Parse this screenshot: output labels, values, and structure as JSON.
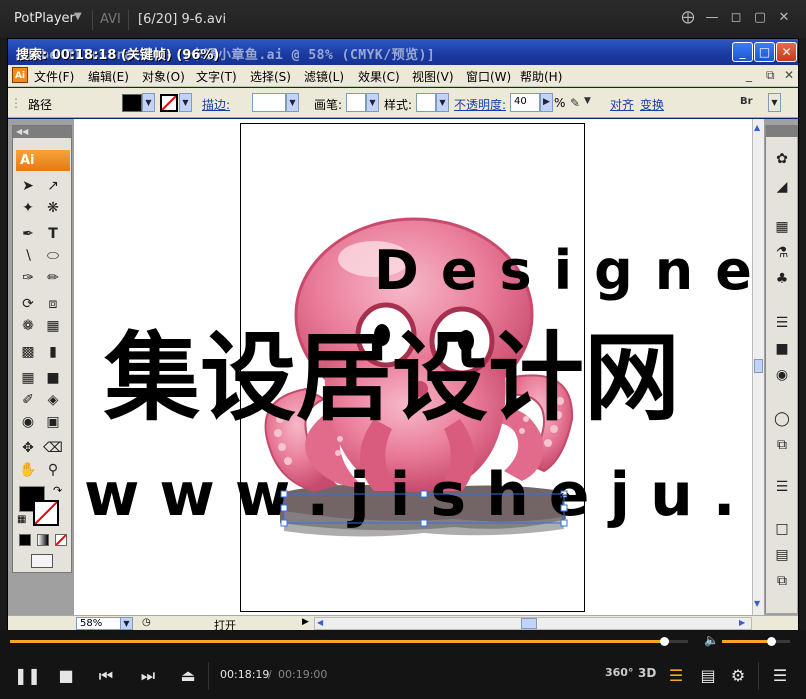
{
  "player": {
    "brand": "PotPlayer",
    "tab_avi": "AVI",
    "tab_file": "[6/20] 9-6.avi",
    "time_current": "00:18:19",
    "time_separator": "/",
    "time_total": "00:19:00",
    "progress_fraction": 0.964,
    "volume_fraction": 0.72,
    "overlay_text": "搜索: 00:18:18 (关键帧) (96%)",
    "btn_360": "360°",
    "btn_3d": "3D"
  },
  "window": {
    "title": "Adobe Illustrator - [卡通小章鱼.ai @ 58% (CMYK/预览)]"
  },
  "menu": [
    "文件(F)",
    "编辑(E)",
    "对象(O)",
    "文字(T)",
    "选择(S)",
    "滤镜(L)",
    "效果(C)",
    "视图(V)",
    "窗口(W)",
    "帮助(H)"
  ],
  "control_bar": {
    "mode_label": "路径",
    "stroke_label": "描边:",
    "brush_label": "画笔:",
    "style_label": "样式:",
    "opacity_label": "不透明度:",
    "opacity_value": "40",
    "percent": "%",
    "align_label": "对齐",
    "transform_label": "变换"
  },
  "toolpanel": {
    "logo": "Ai"
  },
  "status": {
    "zoom": "58%",
    "status_text": "打开"
  },
  "watermark": {
    "main": "集设居设计网",
    "sub": "Designer",
    "url": "www.jisheju.com"
  },
  "colors": {
    "accent": "#f5a623",
    "octopus": "#e9708f",
    "selection": "#3a6fdc",
    "title_blue": "#1a3aa0"
  }
}
